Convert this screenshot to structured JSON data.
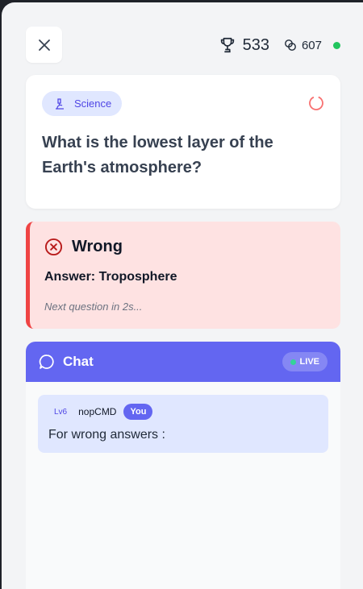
{
  "header": {
    "score": "533",
    "coins": "607",
    "trophy_icon": "trophy-icon",
    "coins_icon": "coins-icon",
    "close_icon": "close-icon",
    "online_color": "#22c55e"
  },
  "question": {
    "category": "Science",
    "category_icon": "microscope-icon",
    "text": "What is the lowest layer of the Earth's atmosphere?"
  },
  "result": {
    "title": "Wrong",
    "answer": "Answer: Troposphere",
    "next": "Next question in 2s...",
    "color": "#ef4444"
  },
  "chat": {
    "title": "Chat",
    "live_label": "LIVE",
    "accent": "#6366f1",
    "messages": [
      {
        "level": "Lv6",
        "user": "nopCMD",
        "badge": "You",
        "text": "For wrong answers :"
      }
    ]
  }
}
